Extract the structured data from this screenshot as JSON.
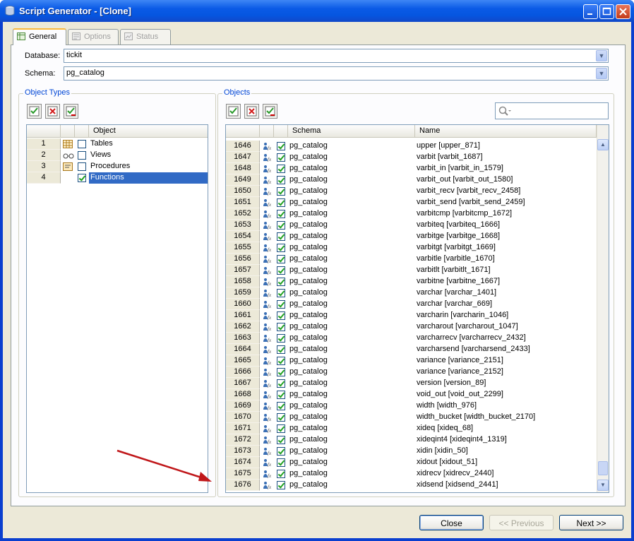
{
  "window": {
    "title": "Script Generator - [Clone]"
  },
  "tabs": [
    {
      "label": "General"
    },
    {
      "label": "Options"
    },
    {
      "label": "Status"
    }
  ],
  "database": {
    "label": "Database:",
    "value": "tickit"
  },
  "schema": {
    "label": "Schema:",
    "value": "pg_catalog"
  },
  "object_types": {
    "title": "Object Types",
    "header": "Object",
    "rows": [
      {
        "num": "1",
        "label": "Tables",
        "checked": false,
        "icon": "table-icon"
      },
      {
        "num": "2",
        "label": "Views",
        "checked": false,
        "icon": "view-glasses-icon"
      },
      {
        "num": "3",
        "label": "Procedures",
        "checked": false,
        "icon": "procedure-icon"
      },
      {
        "num": "4",
        "label": "Functions",
        "checked": true,
        "icon": "function-icon",
        "selected": true
      }
    ]
  },
  "objects": {
    "title": "Objects",
    "search_placeholder": "",
    "columns": [
      "Schema",
      "Name"
    ],
    "rows": [
      {
        "num": "1646",
        "schema": "pg_catalog",
        "name": "upper [upper_871]"
      },
      {
        "num": "1647",
        "schema": "pg_catalog",
        "name": "varbit [varbit_1687]"
      },
      {
        "num": "1648",
        "schema": "pg_catalog",
        "name": "varbit_in [varbit_in_1579]"
      },
      {
        "num": "1649",
        "schema": "pg_catalog",
        "name": "varbit_out [varbit_out_1580]"
      },
      {
        "num": "1650",
        "schema": "pg_catalog",
        "name": "varbit_recv [varbit_recv_2458]"
      },
      {
        "num": "1651",
        "schema": "pg_catalog",
        "name": "varbit_send [varbit_send_2459]"
      },
      {
        "num": "1652",
        "schema": "pg_catalog",
        "name": "varbitcmp [varbitcmp_1672]"
      },
      {
        "num": "1653",
        "schema": "pg_catalog",
        "name": "varbiteq [varbiteq_1666]"
      },
      {
        "num": "1654",
        "schema": "pg_catalog",
        "name": "varbitge [varbitge_1668]"
      },
      {
        "num": "1655",
        "schema": "pg_catalog",
        "name": "varbitgt [varbitgt_1669]"
      },
      {
        "num": "1656",
        "schema": "pg_catalog",
        "name": "varbitle [varbitle_1670]"
      },
      {
        "num": "1657",
        "schema": "pg_catalog",
        "name": "varbitlt [varbitlt_1671]"
      },
      {
        "num": "1658",
        "schema": "pg_catalog",
        "name": "varbitne [varbitne_1667]"
      },
      {
        "num": "1659",
        "schema": "pg_catalog",
        "name": "varchar [varchar_1401]"
      },
      {
        "num": "1660",
        "schema": "pg_catalog",
        "name": "varchar [varchar_669]"
      },
      {
        "num": "1661",
        "schema": "pg_catalog",
        "name": "varcharin [varcharin_1046]"
      },
      {
        "num": "1662",
        "schema": "pg_catalog",
        "name": "varcharout [varcharout_1047]"
      },
      {
        "num": "1663",
        "schema": "pg_catalog",
        "name": "varcharrecv [varcharrecv_2432]"
      },
      {
        "num": "1664",
        "schema": "pg_catalog",
        "name": "varcharsend [varcharsend_2433]"
      },
      {
        "num": "1665",
        "schema": "pg_catalog",
        "name": "variance [variance_2151]"
      },
      {
        "num": "1666",
        "schema": "pg_catalog",
        "name": "variance [variance_2152]"
      },
      {
        "num": "1667",
        "schema": "pg_catalog",
        "name": "version [version_89]"
      },
      {
        "num": "1668",
        "schema": "pg_catalog",
        "name": "void_out [void_out_2299]"
      },
      {
        "num": "1669",
        "schema": "pg_catalog",
        "name": "width [width_976]"
      },
      {
        "num": "1670",
        "schema": "pg_catalog",
        "name": "width_bucket [width_bucket_2170]"
      },
      {
        "num": "1671",
        "schema": "pg_catalog",
        "name": "xideq [xideq_68]"
      },
      {
        "num": "1672",
        "schema": "pg_catalog",
        "name": "xideqint4 [xideqint4_1319]"
      },
      {
        "num": "1673",
        "schema": "pg_catalog",
        "name": "xidin [xidin_50]"
      },
      {
        "num": "1674",
        "schema": "pg_catalog",
        "name": "xidout [xidout_51]"
      },
      {
        "num": "1675",
        "schema": "pg_catalog",
        "name": "xidrecv [xidrecv_2440]"
      },
      {
        "num": "1676",
        "schema": "pg_catalog",
        "name": "xidsend [xidsend_2441]"
      }
    ]
  },
  "buttons": {
    "close": "Close",
    "previous": "<< Previous",
    "next": "Next >>"
  },
  "colors": {
    "selection": "#316ac5",
    "group_title": "#0046d5",
    "annotation_arrow": "#c0171a"
  }
}
